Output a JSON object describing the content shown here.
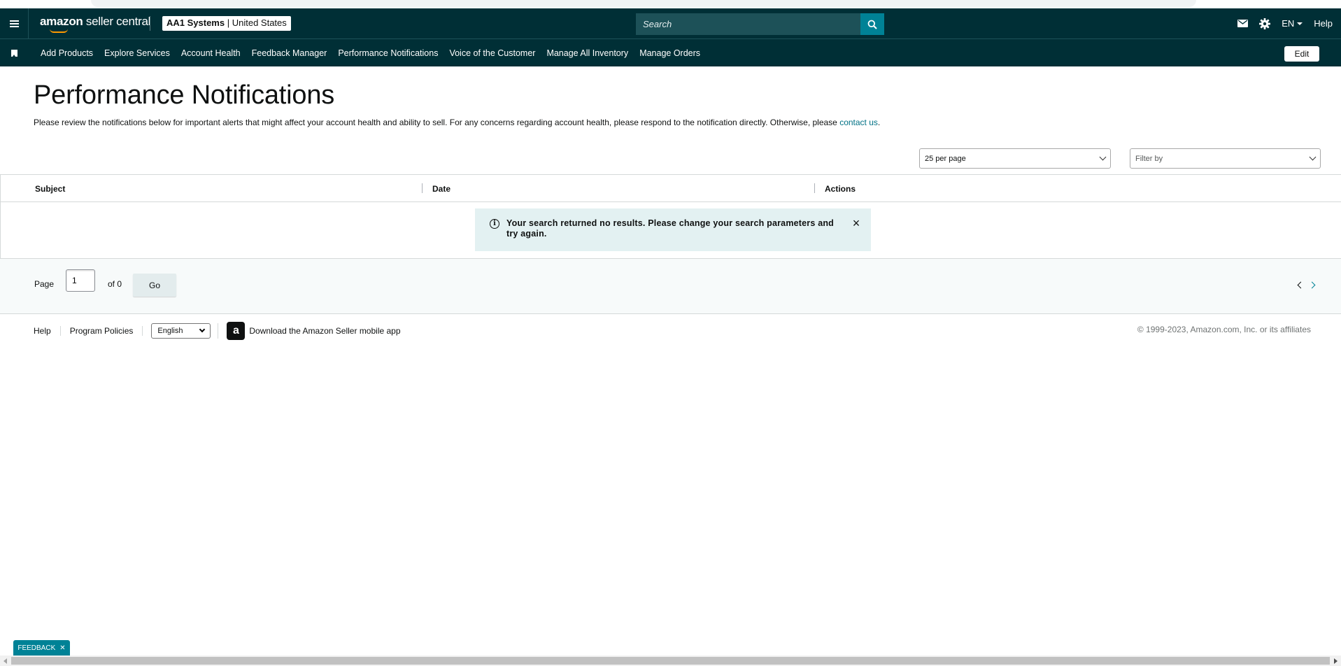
{
  "header": {
    "logo_bold": "amazon",
    "logo_rest": " seller central",
    "account_name": "AA1 Systems",
    "account_region": "United States",
    "search_placeholder": "Search",
    "language": "EN",
    "help_label": "Help"
  },
  "nav": {
    "items": [
      {
        "label": "Add Products"
      },
      {
        "label": "Explore Services"
      },
      {
        "label": "Account Health"
      },
      {
        "label": "Feedback Manager"
      },
      {
        "label": "Performance Notifications"
      },
      {
        "label": "Voice of the Customer"
      },
      {
        "label": "Manage All Inventory"
      },
      {
        "label": "Manage Orders"
      }
    ],
    "edit_label": "Edit"
  },
  "main": {
    "title": "Performance Notifications",
    "subtitle": "Please review the notifications below for important alerts that might affect your account health and ability to sell. For any concerns regarding account health, please respond to the notification directly. Otherwise, please ",
    "contact_link": "contact us",
    "subtitle_end": ".",
    "per_page_value": "25 per page",
    "filter_placeholder": "Filter by"
  },
  "table": {
    "columns": [
      "Subject",
      "Date",
      "Actions"
    ],
    "alert_message": "Your search returned no results. Please change your search parameters and try again."
  },
  "pager": {
    "page_label": "Page",
    "page_value": "1",
    "of_label": "of 0",
    "go_label": "Go"
  },
  "footer": {
    "help_label": "Help",
    "policies_label": "Program Policies",
    "language_value": "English",
    "app_icon_letter": "a",
    "app_label": "Download the Amazon Seller mobile app",
    "copyright": "© 1999-2023, Amazon.com, Inc. or its affiliates"
  },
  "feedback_tab": {
    "label": "FEEDBACK"
  },
  "colors": {
    "header_bg": "#002f36",
    "accent": "#008296",
    "alert_bg": "#e3f1f2",
    "link": "#007185"
  }
}
